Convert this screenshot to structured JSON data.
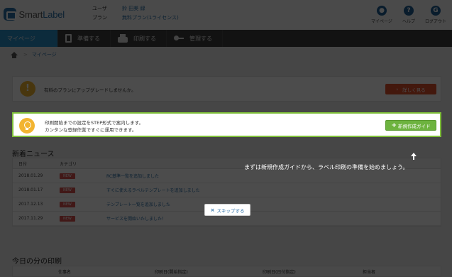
{
  "header": {
    "logo_text_1": "Smart",
    "logo_text_2": "Label",
    "account": [
      {
        "label": "ユーザ",
        "value": "鈴 田美 緑"
      },
      {
        "label": "プラン",
        "value": "無料プラン(1ライセンス)"
      }
    ],
    "links": [
      {
        "icon": "user-icon",
        "label": "マイページ",
        "glyph": "●"
      },
      {
        "icon": "help-icon",
        "label": "ヘルプ",
        "glyph": "?"
      },
      {
        "icon": "logout-icon",
        "label": "ログアウト",
        "glyph": "G"
      }
    ]
  },
  "nav": {
    "items": [
      {
        "label": "マイページ",
        "icon": "",
        "active": true
      },
      {
        "label": "準備する",
        "icon": "document-icon"
      },
      {
        "label": "印刷する",
        "icon": "printer-icon"
      },
      {
        "label": "管理する",
        "icon": "key-icon"
      }
    ]
  },
  "breadcrumb": {
    "current": "マイページ"
  },
  "alert": {
    "text": "有料のプランにアップグレードしませんか。",
    "button": "詳しく見る"
  },
  "guide": {
    "line1": "印刷開始までの設定をSTEP形式で案内します。",
    "line2": "カンタンな登録作業ですぐに運用できます。",
    "button": "新規作成ガイド"
  },
  "tutorial": {
    "tip": "まずは新規作成ガイドから、ラベル印刷の準備を始めましょう。",
    "skip": "スキップする"
  },
  "news": {
    "title": "新着ニュース",
    "headers": {
      "date": "日付",
      "category": "カテゴリ"
    },
    "rows": [
      {
        "date": "2018.01.29",
        "badge": "NEW",
        "text": "RC基準一覧を追加しました"
      },
      {
        "date": "2018.01.17",
        "badge": "NEW",
        "text": "すぐに使えるラベルテンプレートを追加しました"
      },
      {
        "date": "2017.12.13",
        "badge": "NEW",
        "text": "テンプレート一覧を追加しました"
      },
      {
        "date": "2017.11.29",
        "badge": "NEW",
        "text": "サービスを開始いたしました！"
      }
    ]
  },
  "print_today": {
    "title": "今日の分の印刷",
    "headers": [
      "仕事名",
      "印刷日(開始指定)",
      "印刷日(日付指定)",
      "担当者"
    ]
  }
}
